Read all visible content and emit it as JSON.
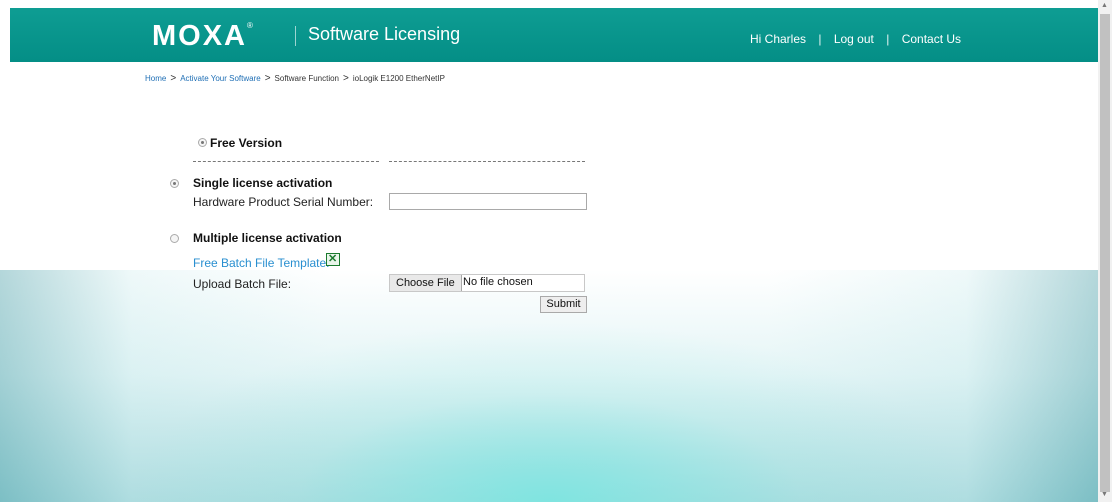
{
  "header": {
    "logo_text": "MOXA",
    "logo_mark": "®",
    "app_title": "Software Licensing",
    "greeting": "Hi Charles",
    "logout": "Log out",
    "contact": "Contact Us",
    "separator": "|"
  },
  "breadcrumb": {
    "home": "Home",
    "step1": "Activate Your Software",
    "step2": "Software Function",
    "step3": "ioLogik E1200 EtherNetIP",
    "sep": ">"
  },
  "form": {
    "free_version_label": "Free Version",
    "single_label": "Single license activation",
    "serial_label": "Hardware Product Serial Number:",
    "serial_value": "",
    "multiple_label": "Multiple license activation",
    "template_link": "Free Batch File Template:",
    "upload_label": "Upload Batch File:",
    "choose_file_button": "Choose File",
    "file_status": "No file chosen",
    "submit_button": "Submit"
  },
  "colors": {
    "header": "#0a968d",
    "link": "#2a8fd0"
  },
  "icons": {
    "excel": "excel-icon"
  },
  "scrollbar": {
    "up": "▲",
    "down": "▼"
  }
}
